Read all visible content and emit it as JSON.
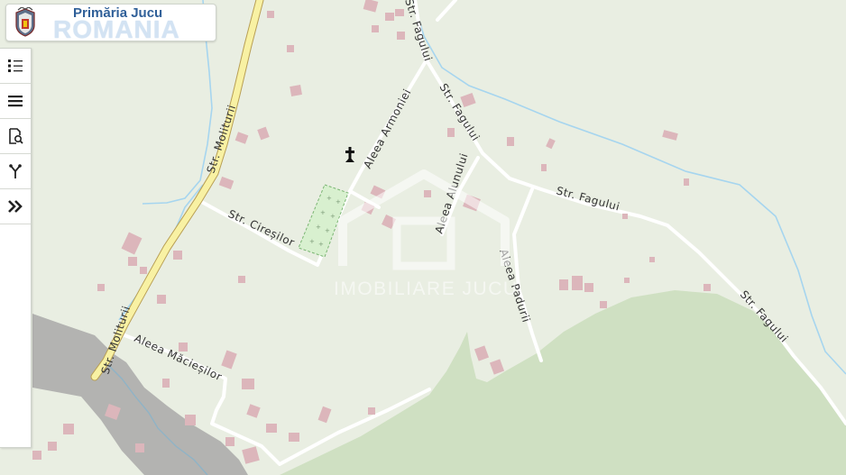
{
  "branding": {
    "title": "Primăria Jucu",
    "country": "ROMANIA"
  },
  "toolbar": {
    "buttons": [
      {
        "icon": "legend-list-icon"
      },
      {
        "icon": "menu-icon"
      },
      {
        "icon": "document-search-icon"
      },
      {
        "icon": "route-branch-icon"
      },
      {
        "icon": "expand-chevrons-icon"
      }
    ]
  },
  "map": {
    "street_labels": [
      "Str. Moliturii",
      "Str. Moliturii",
      "Str. Fagului",
      "Str. Fagului",
      "Str. Fagului",
      "Str. Fagului",
      "Aleea Armoniei",
      "Aleea Alunului",
      "Aleea Padurii",
      "Str. Cireșilor",
      "Aleea Măcieșilor"
    ],
    "watermark": "IMOBILIARE JUCU",
    "colors": {
      "background": "#e9eee2",
      "forest": "#cfe0c2",
      "river": "#b3b3b1",
      "main_road": "#f8f1a3",
      "stream": "#9fd0ec",
      "building": "#dcb6bb",
      "cemetery": "#d8f0cf"
    }
  }
}
